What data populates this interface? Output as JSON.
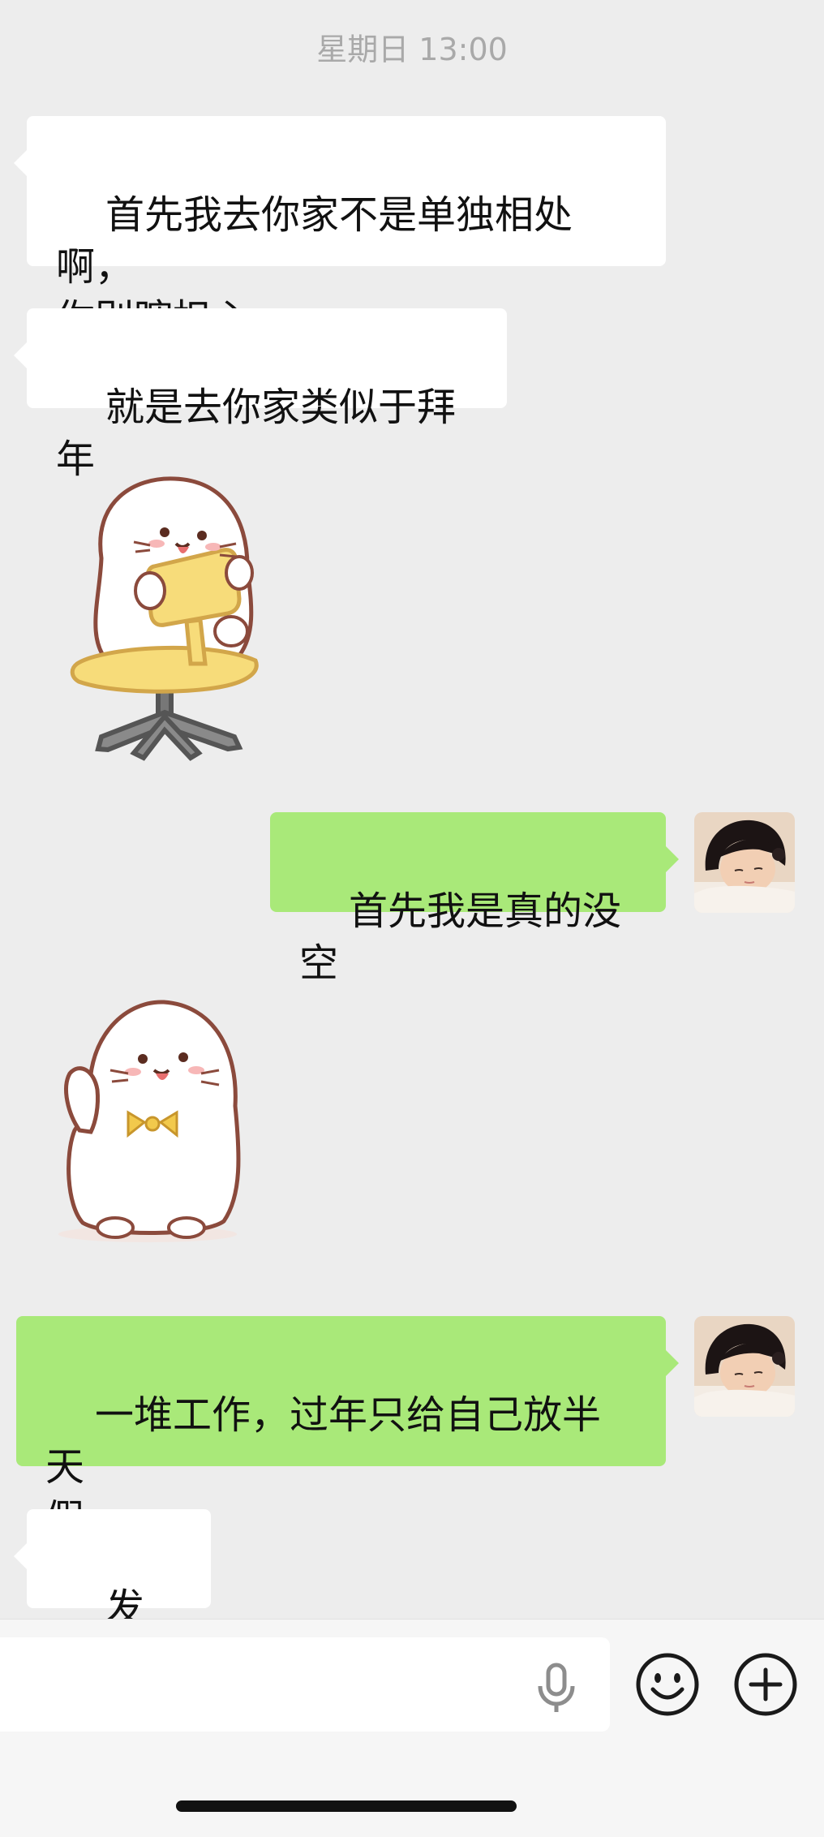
{
  "timestamp": "星期日 13:00",
  "messages": [
    {
      "from": "other",
      "type": "text",
      "text": "首先我去你家不是单独相处啊，\n你别瞎担心"
    },
    {
      "from": "other",
      "type": "text",
      "text": "就是去你家类似于拜年"
    },
    {
      "from": "other",
      "type": "sticker",
      "sticker": "seal-on-office-chair"
    },
    {
      "from": "me",
      "type": "text",
      "text": "首先我是真的没空"
    },
    {
      "from": "other",
      "type": "sticker",
      "sticker": "seal-waving-bowtie"
    },
    {
      "from": "me",
      "type": "text",
      "text": "一堆工作，过年只给自己放半天\n假"
    },
    {
      "from": "other",
      "type": "text",
      "text": "发财了"
    }
  ],
  "input_bar": {
    "voice_icon": "mic-icon",
    "emoji_icon": "smile-icon",
    "more_icon": "plus-icon"
  },
  "colors": {
    "background": "#ededed",
    "bubble_in": "#ffffff",
    "bubble_out": "#a9e979",
    "timestamp": "#a9a9a9"
  }
}
